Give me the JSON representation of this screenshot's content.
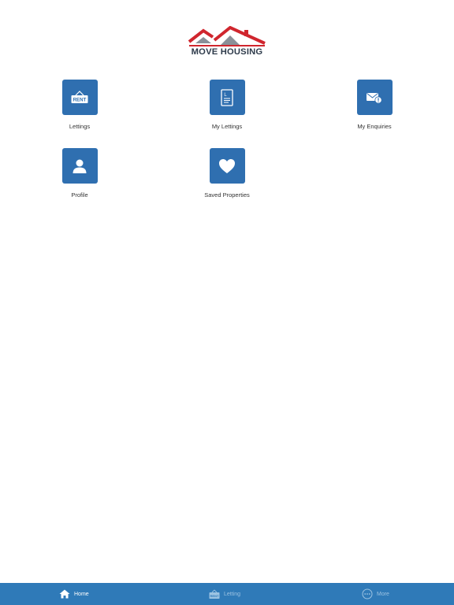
{
  "brand": {
    "logo_text": "MOVE HOUSING",
    "roof_color": "#d0262e",
    "roof_grey": "#8a9098"
  },
  "accent_color": "#2f6fb0",
  "tiles": [
    {
      "label": "Lettings",
      "icon": "rent-sign-icon",
      "icon_text": "RENT"
    },
    {
      "label": "My Lettings",
      "icon": "document-icon",
      "icon_text": "L"
    },
    {
      "label": "My Enquiries",
      "icon": "envelope-alert-icon"
    },
    {
      "label": "Profile",
      "icon": "person-icon"
    },
    {
      "label": "Saved Properties",
      "icon": "heart-icon"
    }
  ],
  "tabbar": {
    "background": "#2f7ab8",
    "items": [
      {
        "label": "Home",
        "icon": "home-icon",
        "active": true
      },
      {
        "label": "Letting",
        "icon": "rent-sign-icon",
        "icon_text": "RENT",
        "active": false
      },
      {
        "label": "More",
        "icon": "more-dots-icon",
        "active": false
      }
    ]
  }
}
